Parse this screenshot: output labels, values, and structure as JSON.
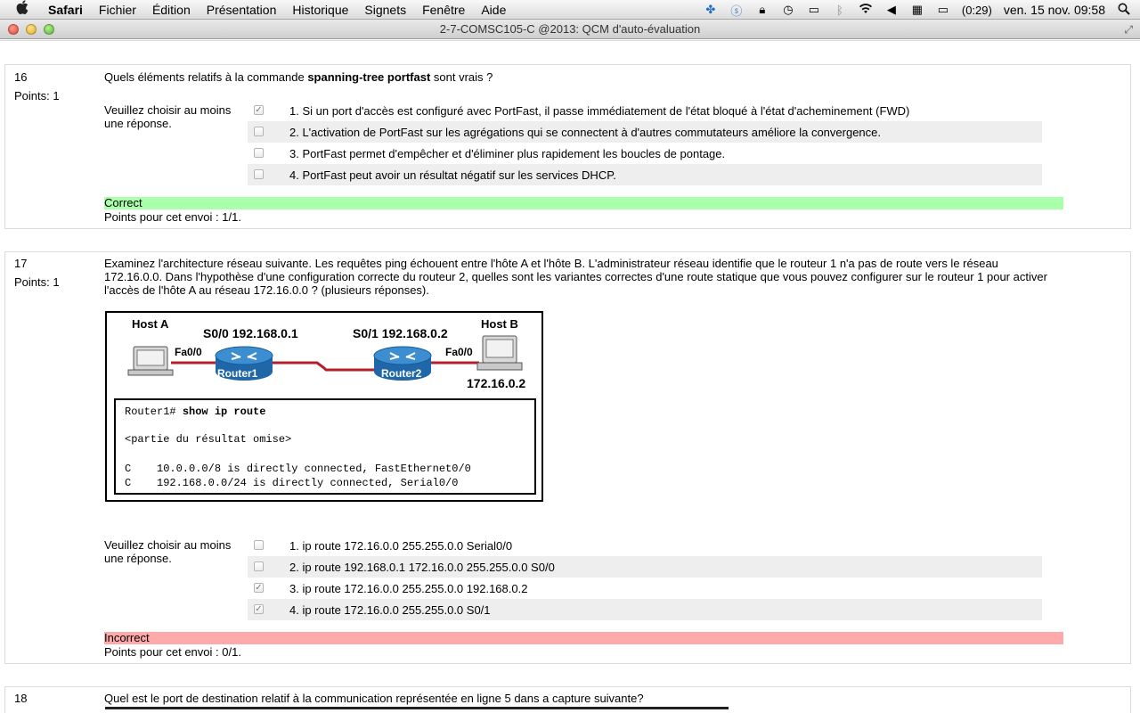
{
  "menubar": {
    "apple": "",
    "app": "Safari",
    "items": [
      "Fichier",
      "Édition",
      "Présentation",
      "Historique",
      "Signets",
      "Fenêtre",
      "Aide"
    ],
    "battery": "(0:29)",
    "clock": "ven. 15 nov.  09:58"
  },
  "window": {
    "title": "2-7-COMSC105-C @2013: QCM d'auto-évaluation"
  },
  "q16": {
    "number": "16",
    "points": "Points: 1",
    "text_before": "Quels éléments relatifs à la commande ",
    "text_bold": "spanning-tree portfast",
    "text_after": " sont vrais ?",
    "choose": "Veuillez choisir au moins une réponse.",
    "options": [
      {
        "label": "1. Si un port d'accès est configuré avec PortFast, il passe immédiatement de l'état bloqué à l'état d'acheminement (FWD)",
        "checked": true
      },
      {
        "label": "2. L'activation de PortFast sur les agrégations qui se connectent à d'autres commutateurs améliore la convergence.",
        "checked": false
      },
      {
        "label": "3. PortFast permet d'empêcher et d'éliminer plus rapidement les boucles de pontage.",
        "checked": false
      },
      {
        "label": "4. PortFast peut avoir un résultat négatif sur les services DHCP.",
        "checked": false
      }
    ],
    "feedback": "Correct",
    "score": "Points pour cet envoi : 1/1."
  },
  "q17": {
    "number": "17",
    "points": "Points: 1",
    "text_l1": "Examinez l'architecture réseau suivante. Les requêtes ping échouent entre l'hôte A et l'hôte B. L'administrateur réseau identifie que le routeur 1 n'a pas de route vers le réseau",
    "text_l2": "172.16.0.0. Dans l'hypothèse d'une configuration correcte du routeur 2, quelles sont les variantes correctes d'une route statique que vous pouvez configurer sur le routeur 1 pour activer",
    "text_l3": "l'accès de l'hôte A au réseau 172.16.0.0 ? (plusieurs réponses).",
    "diagram": {
      "host_a": "Host A",
      "host_b": "Host B",
      "s00": "S0/0 192.168.0.1",
      "s01": "S0/1 192.168.0.2",
      "fa_left": "Fa0/0",
      "fa_right": "Fa0/0",
      "router1": "Router1",
      "router2": "Router2",
      "net_b": "172.16.0.2",
      "cli_prompt": "Router1# ",
      "cli_cmd": "show ip route",
      "cli_omit": "<partie du résultat omise>",
      "cli_r1": "C    10.0.0.0/8 is directly connected, FastEthernet0/0",
      "cli_r2": "C    192.168.0.0/24 is directly connected, Serial0/0"
    },
    "choose": "Veuillez choisir au moins une réponse.",
    "options": [
      {
        "label": "1. ip route 172.16.0.0 255.255.0.0 Serial0/0",
        "checked": false
      },
      {
        "label": "2. ip route 192.168.0.1 172.16.0.0 255.255.0.0 S0/0",
        "checked": false
      },
      {
        "label": "3. ip route 172.16.0.0 255.255.0.0 192.168.0.2",
        "checked": true
      },
      {
        "label": "4. ip route 172.16.0.0 255.255.0.0 S0/1",
        "checked": true
      }
    ],
    "feedback": "Incorrect",
    "score": "Points pour cet envoi : 0/1."
  },
  "q18": {
    "number": "18",
    "text": "Quel est le port de destination relatif à la communication représentée en ligne 5 dans a capture suivante?"
  }
}
